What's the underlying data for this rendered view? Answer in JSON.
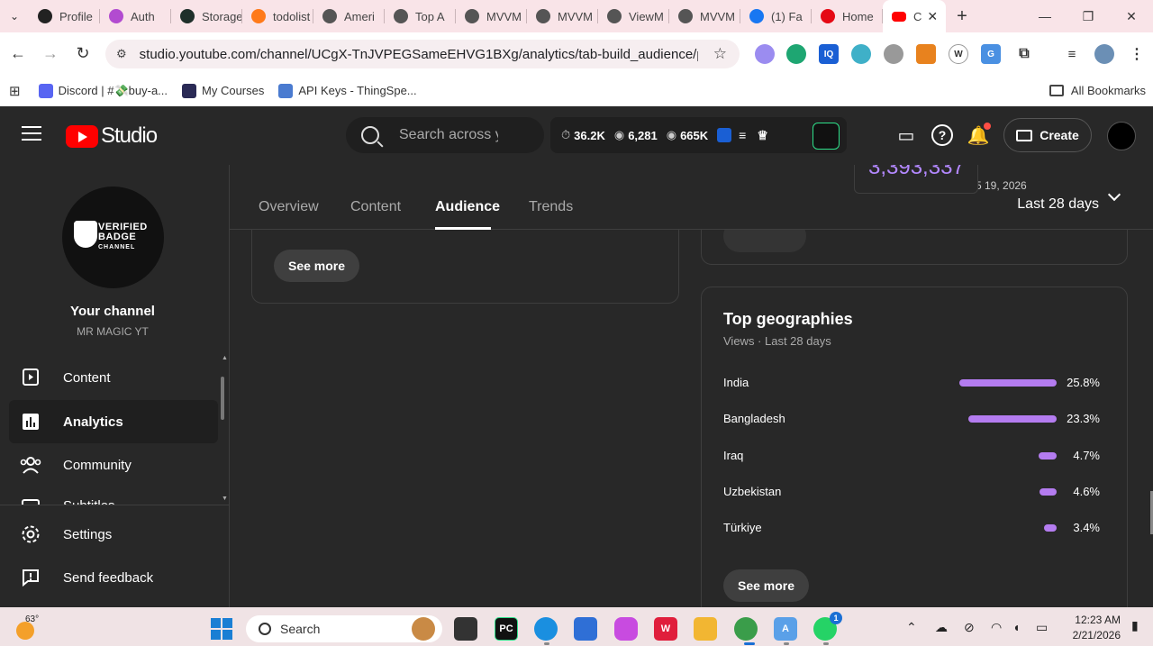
{
  "browser": {
    "tabs": [
      {
        "label": "Profile",
        "color": "#222222"
      },
      {
        "label": "Auth",
        "color": "#b24bd0"
      },
      {
        "label": "Storage",
        "color": "#1f2f2a"
      },
      {
        "label": "todolist",
        "color": "#ff7a1a"
      },
      {
        "label": "Ameri",
        "color": "#555555"
      },
      {
        "label": "Top A",
        "color": "#555555"
      },
      {
        "label": "MVVM",
        "color": "#555555"
      },
      {
        "label": "MVVM",
        "color": "#555555"
      },
      {
        "label": "ViewM",
        "color": "#555555"
      },
      {
        "label": "MVVM",
        "color": "#555555"
      },
      {
        "label": "(1) Fa",
        "color": "#1877f2"
      },
      {
        "label": "Home",
        "color": "#e50914"
      }
    ],
    "active_tab": {
      "label": "C",
      "color": "#ff0000"
    },
    "new_tab": "+",
    "url": "studio.youtube.com/channel/UCgX-TnJVPEGSameEHVG1BXg/analytics/tab-build_audience/period...",
    "bookmarks": [
      {
        "label": "Discord | #💸buy-a...",
        "color": "#5865f2"
      },
      {
        "label": "My Courses",
        "color": "#2a2a55"
      },
      {
        "label": "API Keys - ThingSpe...",
        "color": "#4a7bd0"
      }
    ],
    "all_bookmarks": "All Bookmarks"
  },
  "header": {
    "logo_text": "Studio",
    "search_placeholder": "Search across y",
    "stats": [
      {
        "icon": "⏱",
        "value": "36.2K"
      },
      {
        "icon": "◉",
        "value": "6,281"
      },
      {
        "icon": "◉",
        "value": "665K"
      }
    ],
    "create_label": "Create"
  },
  "sidebar": {
    "channel_title": "Your channel",
    "channel_name": "MR MAGIC YT",
    "badge_line1": "VERIFIED",
    "badge_line2": "BADGE",
    "badge_line3": "CHANNEL",
    "items": [
      {
        "label": "Content",
        "icon": "content-icon"
      },
      {
        "label": "Analytics",
        "icon": "analytics-icon"
      },
      {
        "label": "Community",
        "icon": "community-icon"
      },
      {
        "label": "Subtitles",
        "icon": "subtitles-icon"
      }
    ],
    "bottom_items": [
      {
        "label": "Settings",
        "icon": "gear-icon"
      },
      {
        "label": "Send feedback",
        "icon": "feedback-icon"
      }
    ]
  },
  "main": {
    "tabs": [
      {
        "label": "Overview"
      },
      {
        "label": "Content"
      },
      {
        "label": "Audience"
      },
      {
        "label": "Trends"
      }
    ],
    "active_tab": "Audience",
    "period_label": "Last 28 days",
    "period_date": "5 19, 2026",
    "tooltip_value": "3,393,337",
    "left_card": {
      "see_more": "See more"
    },
    "geo_card": {
      "title": "Top geographies",
      "subtitle": "Views · Last 28 days",
      "rows": [
        {
          "country": "India",
          "pct": "25.8%",
          "value": 25.8
        },
        {
          "country": "Bangladesh",
          "pct": "23.3%",
          "value": 23.3
        },
        {
          "country": "Iraq",
          "pct": "4.7%",
          "value": 4.7
        },
        {
          "country": "Uzbekistan",
          "pct": "4.6%",
          "value": 4.6
        },
        {
          "country": "Türkiye",
          "pct": "3.4%",
          "value": 3.4
        }
      ],
      "see_more": "See more",
      "bar_color": "#b47cf0"
    }
  },
  "taskbar": {
    "temperature": "63°",
    "search_label": "Search",
    "whatsapp_badge": "1",
    "time": "12:23 AM",
    "date": "2/21/2026"
  }
}
